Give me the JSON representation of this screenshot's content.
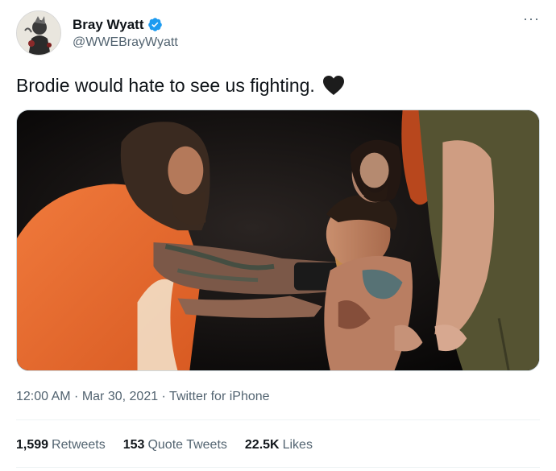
{
  "user": {
    "display_name": "Bray Wyatt",
    "handle": "@WWEBrayWyatt",
    "verified": true
  },
  "tweet": {
    "text": "Brodie would hate to see us fighting.",
    "emoji": "black-heart",
    "time": "12:00 AM",
    "separator1": " · ",
    "date": "Mar 30, 2021",
    "separator2": " · ",
    "source": "Twitter for iPhone"
  },
  "stats": {
    "retweets_count": "1,599",
    "retweets_label": "Retweets",
    "quotes_count": "153",
    "quotes_label": "Quote Tweets",
    "likes_count": "22.5K",
    "likes_label": "Likes"
  },
  "icons": {
    "verified": "verified-badge-icon",
    "more": "more-options-icon",
    "heart": "black-heart-icon"
  },
  "colors": {
    "verified_blue": "#1d9bf0",
    "secondary_text": "#536471",
    "primary_text": "#0f1419"
  }
}
